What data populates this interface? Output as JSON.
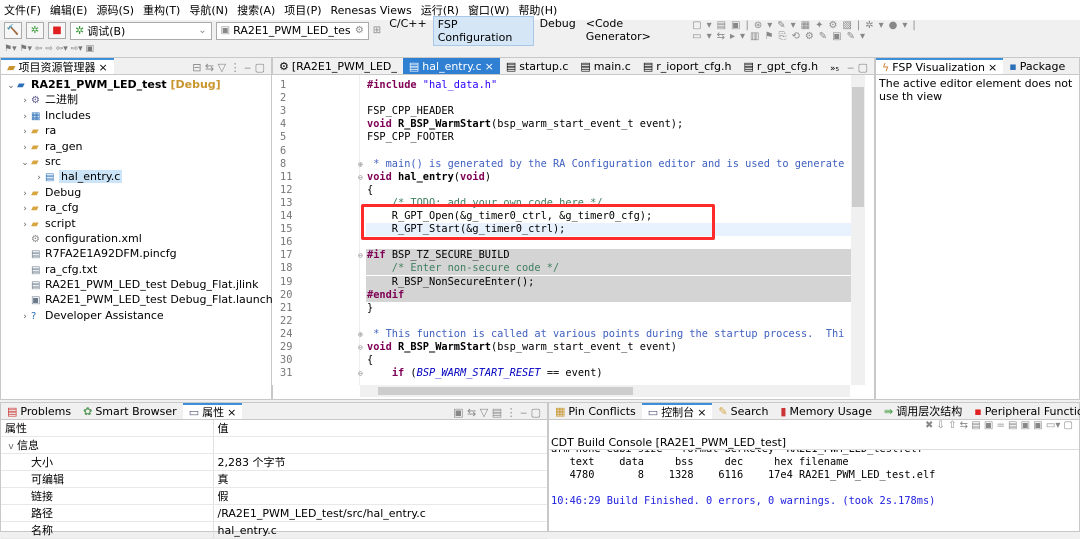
{
  "menu": [
    "文件(F)",
    "编辑(E)",
    "源码(S)",
    "重构(T)",
    "导航(N)",
    "搜索(A)",
    "项目(P)",
    "Renesas Views",
    "运行(R)",
    "窗口(W)",
    "帮助(H)"
  ],
  "toolbar": {
    "build_config": "调试(B)",
    "launch_config": "RA2E1_PWM_LED_tes",
    "perspectives": [
      {
        "label": "C/C++",
        "active": false
      },
      {
        "label": "FSP Configuration",
        "active": true
      },
      {
        "label": "Debug",
        "active": false
      },
      {
        "label": "<Code Generator>",
        "active": false
      }
    ]
  },
  "project_explorer": {
    "title": "项目资源管理器",
    "items": [
      {
        "label": "RA2E1_PWM_LED_test",
        "suffix": " [Debug]",
        "level": 0,
        "twisty": "v",
        "icon": "project-icon"
      },
      {
        "label": "二进制",
        "level": 1,
        "twisty": ">",
        "icon": "binaries-icon"
      },
      {
        "label": "Includes",
        "level": 1,
        "twisty": ">",
        "icon": "includes-icon"
      },
      {
        "label": "ra",
        "level": 1,
        "twisty": ">",
        "icon": "folder-icon"
      },
      {
        "label": "ra_gen",
        "level": 1,
        "twisty": ">",
        "icon": "folder-icon"
      },
      {
        "label": "src",
        "level": 1,
        "twisty": "v",
        "icon": "folder-icon"
      },
      {
        "label": "hal_entry.c",
        "level": 2,
        "twisty": ">",
        "icon": "c-file-icon",
        "selected": true
      },
      {
        "label": "Debug",
        "level": 1,
        "twisty": ">",
        "icon": "folder-icon"
      },
      {
        "label": "ra_cfg",
        "level": 1,
        "twisty": ">",
        "icon": "folder-icon"
      },
      {
        "label": "script",
        "level": 1,
        "twisty": ">",
        "icon": "folder-icon"
      },
      {
        "label": "configuration.xml",
        "level": 1,
        "twisty": "",
        "icon": "gear-icon"
      },
      {
        "label": "R7FA2E1A92DFM.pincfg",
        "level": 1,
        "twisty": "",
        "icon": "file-icon"
      },
      {
        "label": "ra_cfg.txt",
        "level": 1,
        "twisty": "",
        "icon": "file-icon"
      },
      {
        "label": "RA2E1_PWM_LED_test Debug_Flat.jlink",
        "level": 1,
        "twisty": "",
        "icon": "file-icon"
      },
      {
        "label": "RA2E1_PWM_LED_test Debug_Flat.launch",
        "level": 1,
        "twisty": "",
        "icon": "launch-icon"
      },
      {
        "label": "Developer Assistance",
        "level": 1,
        "twisty": ">",
        "icon": "help-icon"
      }
    ]
  },
  "editor": {
    "tabs": [
      {
        "label": "[RA2E1_PWM_LED_",
        "active": false
      },
      {
        "label": "hal_entry.c",
        "active": true
      },
      {
        "label": "startup.c",
        "active": false
      },
      {
        "label": "main.c",
        "active": false
      },
      {
        "label": "r_ioport_cfg.h",
        "active": false
      },
      {
        "label": "r_gpt_cfg.h",
        "active": false
      }
    ],
    "overflow": "»₅",
    "highlight_color": "#ff2a2a",
    "lines": [
      {
        "n": "1",
        "t": [
          [
            "#include ",
            "pp"
          ],
          [
            "\"hal_data.h\"",
            "st"
          ]
        ]
      },
      {
        "n": "2",
        "t": []
      },
      {
        "n": "3",
        "t": [
          [
            "FSP_CPP_HEADER",
            ""
          ]
        ]
      },
      {
        "n": "4",
        "t": [
          [
            "void ",
            "kw"
          ],
          [
            "R_BSP_WarmStart",
            "fn"
          ],
          [
            "(bsp_warm_start_event_t event);",
            ""
          ]
        ]
      },
      {
        "n": "5",
        "t": [
          [
            "FSP_CPP_FOOTER",
            ""
          ]
        ]
      },
      {
        "n": "6",
        "t": []
      },
      {
        "n": "8",
        "fold": "+",
        "t": [
          [
            " * main() is generated by the RA Configuration editor and is used to generate",
            "jd"
          ]
        ]
      },
      {
        "n": "11",
        "fold": "-",
        "t": [
          [
            "void ",
            "kw"
          ],
          [
            "hal_entry",
            "fn"
          ],
          [
            "(",
            ""
          ],
          [
            "void",
            "kw"
          ],
          [
            ")",
            ""
          ]
        ]
      },
      {
        "n": "12",
        "t": [
          [
            "{",
            ""
          ]
        ]
      },
      {
        "n": "13",
        "t": [
          [
            "    /* TODO: add your own code here */",
            "cm"
          ]
        ]
      },
      {
        "n": "14",
        "t": [
          [
            "    R_GPT_Open(&g_timer0_ctrl, &g_timer0_cfg);",
            ""
          ]
        ]
      },
      {
        "n": "15",
        "cur": true,
        "t": [
          [
            "    R_GPT_Start(&g_timer0_ctrl);",
            ""
          ]
        ]
      },
      {
        "n": "16",
        "t": []
      },
      {
        "n": "17",
        "fold": "-",
        "grey": true,
        "t": [
          [
            "#if ",
            "pp"
          ],
          [
            "BSP_TZ_SECURE_BUILD",
            ""
          ]
        ]
      },
      {
        "n": "18",
        "grey": true,
        "t": [
          [
            "    /* Enter non-secure code */",
            "cm"
          ]
        ]
      },
      {
        "n": "19",
        "grey": true,
        "t": [
          [
            "    R_BSP_NonSecureEnter();",
            ""
          ]
        ]
      },
      {
        "n": "20",
        "grey": true,
        "t": [
          [
            "#endif",
            "pp"
          ]
        ]
      },
      {
        "n": "21",
        "t": [
          [
            "}",
            ""
          ]
        ]
      },
      {
        "n": "22",
        "t": []
      },
      {
        "n": "24",
        "fold": "+",
        "t": [
          [
            " * This function is called at various points during the startup process.  Thi",
            "jd"
          ]
        ]
      },
      {
        "n": "29",
        "fold": "-",
        "t": [
          [
            "void ",
            "kw"
          ],
          [
            "R_BSP_WarmStart",
            "fn"
          ],
          [
            "(bsp_warm_start_event_t event)",
            ""
          ]
        ]
      },
      {
        "n": "30",
        "t": [
          [
            "{",
            ""
          ]
        ]
      },
      {
        "n": "31",
        "fold": "-",
        "t": [
          [
            "    ",
            ""
          ],
          [
            "if ",
            "kw"
          ],
          [
            "(",
            ""
          ],
          [
            "BSP_WARM_START_RESET",
            "mc"
          ],
          [
            " == event)",
            ""
          ]
        ]
      }
    ]
  },
  "fsp_visualization": {
    "tabs": [
      "FSP Visualization",
      "Package"
    ],
    "message": "The active editor element does not use th view"
  },
  "properties": {
    "tabs": [
      "Problems",
      "Smart Browser",
      "属性"
    ],
    "headers": [
      "属性",
      "值"
    ],
    "group": "信息",
    "rows": [
      [
        "大小",
        "2,283 个字节"
      ],
      [
        "可编辑",
        "真"
      ],
      [
        "链接",
        "假"
      ],
      [
        "路径",
        "/RA2E1_PWM_LED_test/src/hal_entry.c"
      ],
      [
        "名称",
        "hal_entry.c"
      ]
    ]
  },
  "console": {
    "tabs": [
      "Pin Conflicts",
      "控制台",
      "Search",
      "Memory Usage",
      "调用层次结构",
      "Peripheral Functions"
    ],
    "title": "CDT Build Console [RA2E1_PWM_LED_test]",
    "lines": [
      "arm-none-eabi-size --format=berkeley \"RA2E1_PWM_LED_test.elf\"",
      "   text    data     bss     dec     hex filename",
      "   4780       8    1328    6116    17e4 RA2E1_PWM_LED_test.elf",
      "",
      ""
    ],
    "finished": "10:46:29 Build Finished. 0 errors, 0 warnings. (took 2s.178ms)"
  }
}
